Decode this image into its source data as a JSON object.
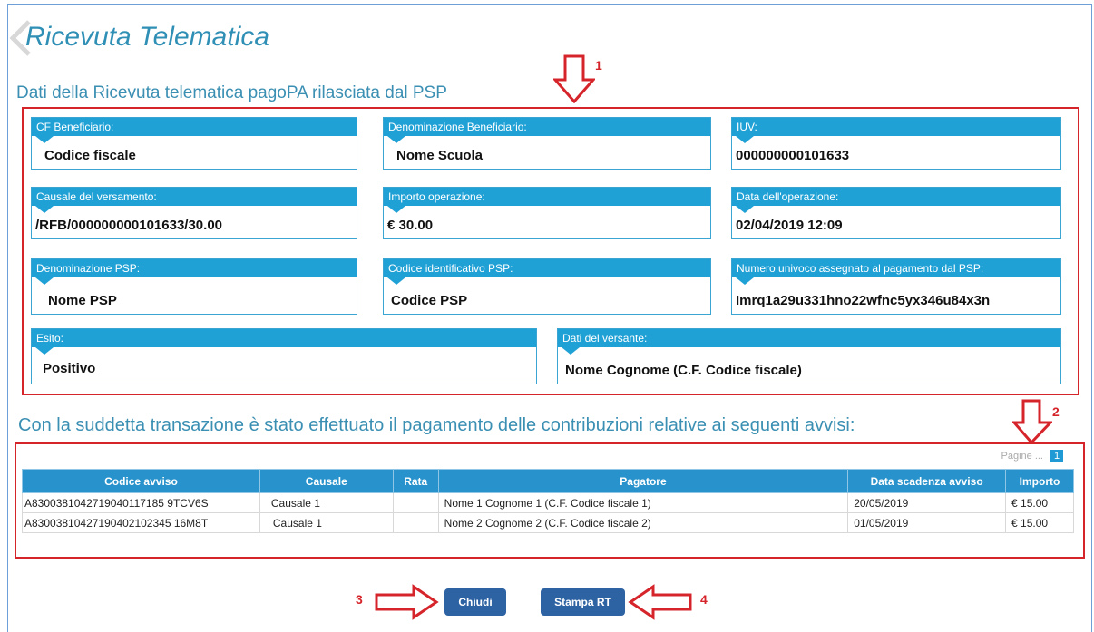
{
  "page": {
    "title": "Ricevuta Telematica",
    "section_title": "Dati della Ricevuta telematica pagoPA rilasciata dal PSP",
    "section2_title": "Con la suddetta transazione è stato effettuato il pagamento delle contribuzioni relative ai seguenti avvisi:"
  },
  "fields": {
    "cf_beneficiario": {
      "label": "CF Beneficiario:",
      "value": "Codice fiscale"
    },
    "denominazione_beneficiario": {
      "label": "Denominazione Beneficiario:",
      "value": "Nome Scuola"
    },
    "iuv": {
      "label": "IUV:",
      "value": "000000000101633"
    },
    "causale": {
      "label": "Causale del versamento:",
      "value": "/RFB/000000000101633/30.00"
    },
    "importo": {
      "label": "Importo operazione:",
      "value": "€ 30.00"
    },
    "data_operazione": {
      "label": "Data dell'operazione:",
      "value": "02/04/2019 12:09"
    },
    "denominazione_psp": {
      "label": "Denominazione PSP:",
      "value": "Nome PSP"
    },
    "codice_psp": {
      "label": "Codice identificativo PSP:",
      "value": "Codice PSP"
    },
    "numero_univoco": {
      "label": "Numero univoco assegnato al pagamento dal PSP:",
      "value": "Imrq1a29u331hno22wfnc5yx346u84x3n"
    },
    "esito": {
      "label": "Esito:",
      "value": "Positivo"
    },
    "versante": {
      "label": "Dati del versante:",
      "value": "Nome Cognome (C.F. Codice fiscale)"
    }
  },
  "pager": {
    "label": "Pagine ...",
    "page": "1"
  },
  "table": {
    "headers": [
      "Codice avviso",
      "Causale",
      "Rata",
      "Pagatore",
      "Data scadenza avviso",
      "Importo"
    ],
    "rows": [
      [
        "A8300381042719040117185 9TCV6S",
        "Causale 1",
        "",
        "Nome 1 Cognome 1 (C.F. Codice fiscale 1)",
        "20/05/2019",
        "€ 15.00"
      ],
      [
        "A83003810427190402102345 16M8T",
        "Causale 1",
        "",
        "Nome 2 Cognome 2 (C.F. Codice fiscale 2)",
        "01/05/2019",
        "€ 15.00"
      ]
    ]
  },
  "buttons": {
    "close": "Chiudi",
    "print": "Stampa RT"
  },
  "annotations": [
    "1",
    "2",
    "3",
    "4"
  ],
  "colors": {
    "accent": "#20a1d6",
    "annotation": "#d6242b",
    "button": "#2d62a3"
  }
}
